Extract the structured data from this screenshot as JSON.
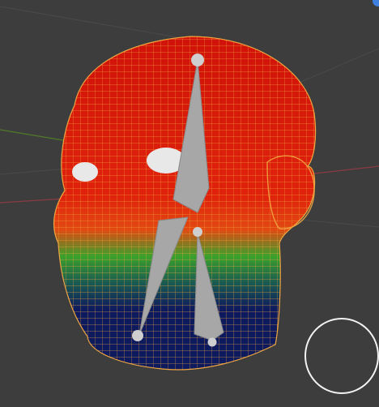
{
  "viewport": {
    "mode": "weight-paint",
    "background": "#3d3d3d",
    "grid_line_color": "#4a4a4a",
    "x_axis_color": "#8a3b44",
    "y_axis_color": "#4f7a2a"
  },
  "mesh": {
    "name": "head",
    "wire_color": "#f0a640",
    "weight_gradient": {
      "high": "#d0120a",
      "upper_mid": "#e24a12",
      "mid": "#3aa12c",
      "low_mid": "#1a5a52",
      "low": "#0e1a5e"
    },
    "eye_color": "#e8e8e8"
  },
  "armature": {
    "bone_color": "#a7a7a7",
    "joint_color": "#cfcfcf",
    "bone_count": 3
  },
  "overlay": {
    "corner_indicator_color": "#3f7fe0",
    "brush_circle_color": "#f2f2f2"
  }
}
